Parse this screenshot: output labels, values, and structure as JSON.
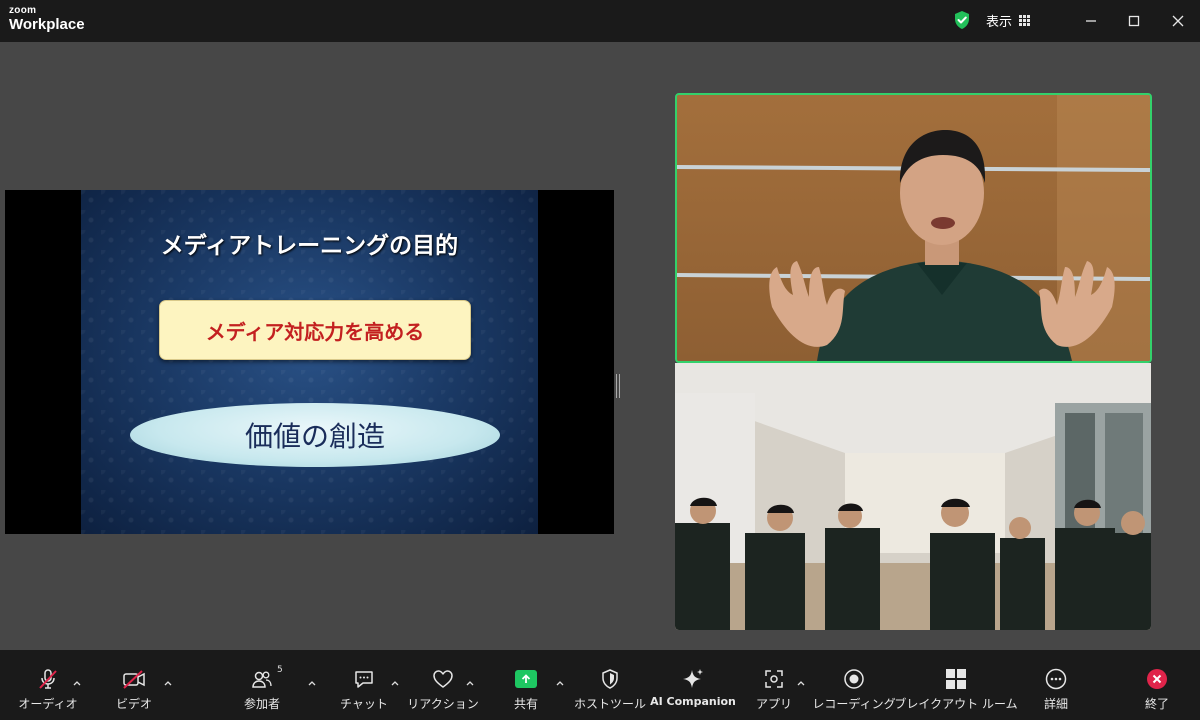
{
  "titlebar": {
    "brand_small": "zoom",
    "brand_big": "Workplace",
    "view_label": "表示",
    "icons": [
      "shield-check-icon",
      "grid-icon",
      "minimize-icon",
      "maximize-icon",
      "close-icon"
    ],
    "shield_color": "#22c05a"
  },
  "slide": {
    "title": "メディアトレーニングの目的",
    "box_text": "メディア対応力を高める",
    "ellipse_text": "価値の創造",
    "box_text_color": "#c32020",
    "ellipse_text_color": "#1a2d5a"
  },
  "active_speaker_color": "#33d16b",
  "toolbar": {
    "audio": "オーディオ",
    "video": "ビデオ",
    "participants": "参加者",
    "participant_count": "5",
    "chat": "チャット",
    "reactions": "リアクション",
    "share": "共有",
    "host_tools": "ホストツール",
    "ai_companion": "AI Companion",
    "apps": "アプリ",
    "recording": "レコーディング",
    "breakout": "ブレイクアウト ルーム",
    "more": "詳細",
    "end": "終了",
    "share_color": "#1ec762",
    "end_color": "#e0244a",
    "muted_color": "#e0244a"
  }
}
